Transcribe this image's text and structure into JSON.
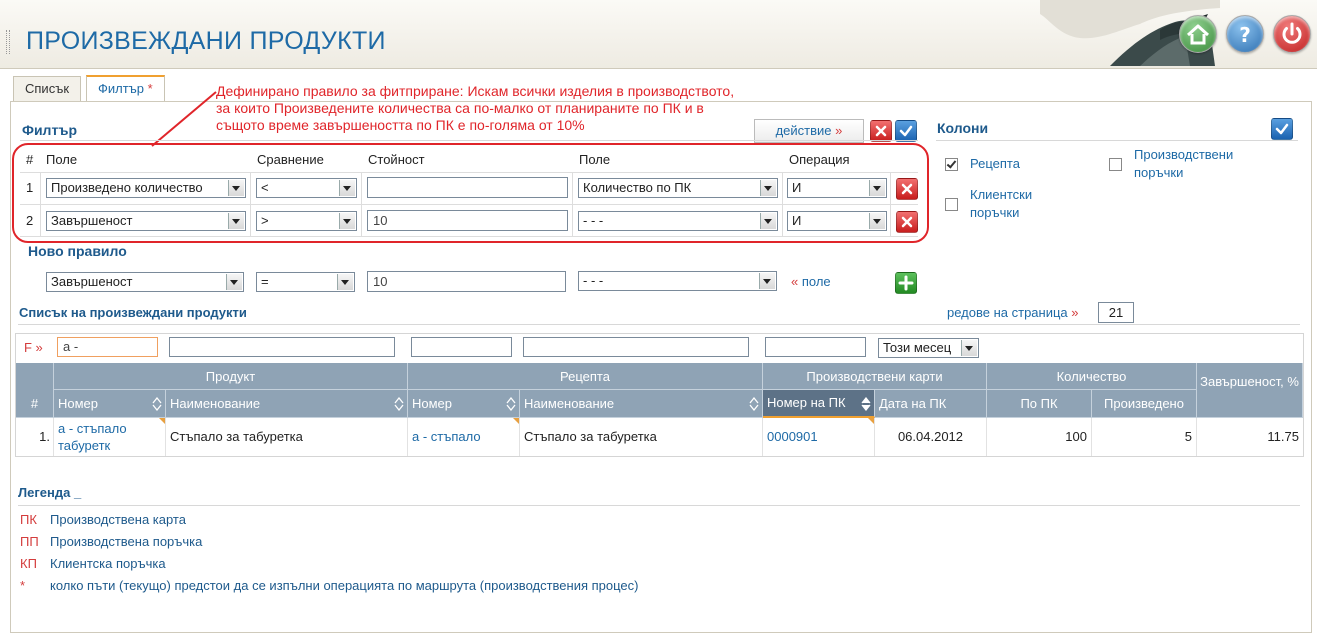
{
  "header": {
    "title": "ПРОИЗВЕЖДАНИ ПРОДУКТИ"
  },
  "tabs": [
    {
      "label": "Списък",
      "active": false
    },
    {
      "label": "Филтър",
      "marker": "*",
      "active": true
    }
  ],
  "annotation": {
    "line1": "Дефинирано правило за фитприране: Искам всички изделия в производството,",
    "line2": "за които Произведените количества са по-малко от планираните по ПК и в",
    "line3": "същото време завършеността по ПК е по-голяма от 10%"
  },
  "filter": {
    "title": "Филтър",
    "action_label": "действие",
    "action_arrow": "»",
    "headers": {
      "num": "#",
      "field": "Поле",
      "compare": "Сравнение",
      "value": "Стойност",
      "field2": "Поле",
      "operation": "Операция"
    },
    "rules": [
      {
        "num": "1",
        "field": "Произведено количество",
        "compare": "<",
        "value": "",
        "field2": "Количество по ПК",
        "operation": "И"
      },
      {
        "num": "2",
        "field": "Завършеност",
        "compare": ">",
        "value": "10",
        "field2": "- - -",
        "operation": "И"
      }
    ],
    "new_rule": {
      "title": "Ново правило",
      "field": "Завършеност",
      "compare": "=",
      "value": "10",
      "field2": "- - -",
      "add_arrow": "«",
      "add_label": "поле"
    }
  },
  "columns": {
    "title": "Колони",
    "options": [
      {
        "label": "Рецепта",
        "checked": true
      },
      {
        "label": "Клиентски поръчки",
        "checked": false
      },
      {
        "label": "Производствени поръчки",
        "checked": false
      }
    ]
  },
  "list": {
    "title": "Списък на произвеждани продукти",
    "rows_per_page_label": "редове на страница",
    "rows_per_page_arrow": "»",
    "rows_per_page": "21",
    "filter_row": {
      "marker": "F »",
      "product_number": "а -",
      "product_name": "",
      "recipe_number": "",
      "recipe_name": "",
      "card_number": "",
      "period": "Този месец"
    },
    "groups": {
      "product": "Продукт",
      "recipe": "Рецепта",
      "cards": "Производствени карти",
      "quantity": "Количество",
      "completion": "Завършеност, %"
    },
    "columns": {
      "num": "#",
      "product_number": "Номер",
      "product_name": "Наименование",
      "recipe_number": "Номер",
      "recipe_name": "Наименование",
      "card_number": "Номер на ПК",
      "card_date": "Дата на ПК",
      "qty_planned": "По ПК",
      "qty_produced": "Произведено"
    },
    "rows": [
      {
        "num": "1.",
        "product_number": "а - стъпало табуретк",
        "product_name": "Стъпало за табуретка",
        "recipe_number": "а - стъпало",
        "recipe_name": "Стъпало за табуретка",
        "card_number": "0000901",
        "card_date": "06.04.2012",
        "qty_planned": "100",
        "qty_produced": "5",
        "completion": "11.75"
      }
    ]
  },
  "legend": {
    "title": "Легенда _",
    "items": [
      {
        "abbr": "ПК",
        "text": "Производствена карта"
      },
      {
        "abbr": "ПП",
        "text": "Производствена поръчка"
      },
      {
        "abbr": "КП",
        "text": "Клиентска поръчка"
      },
      {
        "abbr": "*",
        "text": "колко пъти (текущо) предстои да се изпълни операцията по маршрута (производствения процес)"
      }
    ]
  },
  "colors": {
    "title_blue": "#1e6aa6",
    "header_grey_blue": "#8fa3b5",
    "annotation_red": "#e0252a",
    "accent_red": "#d43c3c"
  },
  "icons": [
    "home-icon",
    "help-icon",
    "power-icon",
    "close-icon",
    "check-icon",
    "plus-icon",
    "sort-icon",
    "bird-logo"
  ]
}
